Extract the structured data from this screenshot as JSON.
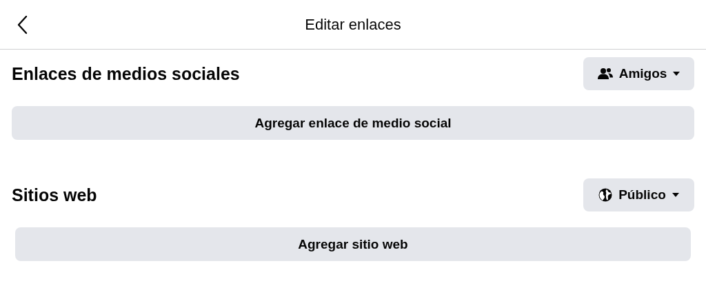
{
  "header": {
    "title": "Editar enlaces"
  },
  "sections": [
    {
      "title": "Enlaces de medios sociales",
      "audience": {
        "kind": "friends",
        "label": "Amigos"
      },
      "button": "Agregar enlace de medio social"
    },
    {
      "title": "Sitios web",
      "audience": {
        "kind": "public",
        "label": "Público"
      },
      "button": "Agregar sitio web"
    }
  ]
}
